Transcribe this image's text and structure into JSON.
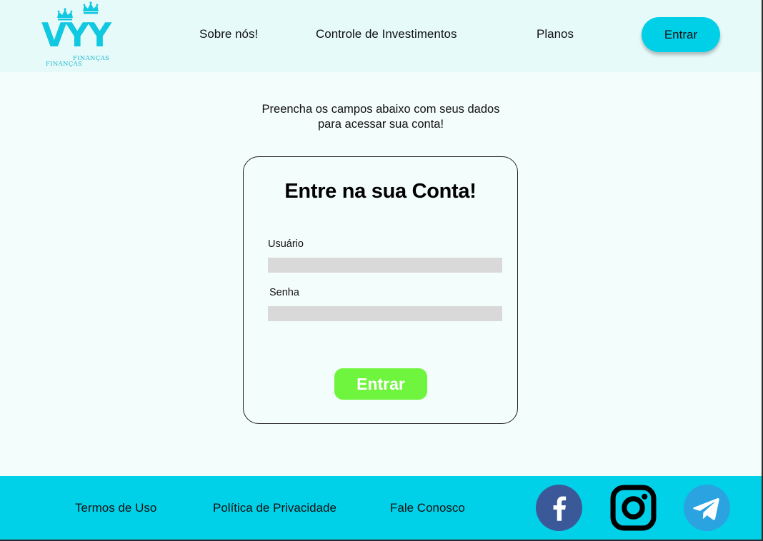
{
  "brand": {
    "logo_text": "VYY",
    "logo_subtitle_1": "FINANÇAS",
    "logo_subtitle_2": "FINANÇAS",
    "color": "#10c8e0"
  },
  "nav": {
    "items": [
      {
        "label": "Sobre nós!"
      },
      {
        "label": "Controle de Investimentos"
      },
      {
        "label": "Planos"
      }
    ],
    "login_button": "Entrar"
  },
  "intro": {
    "line1": "Preencha os campos abaixo com seus dados",
    "line2": "para acessar sua conta!"
  },
  "login_card": {
    "title": "Entre na sua Conta!",
    "user_label": "Usuário",
    "user_value": "",
    "password_label": "Senha",
    "password_value": "",
    "submit_label": "Entrar"
  },
  "footer": {
    "links": [
      {
        "label": "Termos de Uso"
      },
      {
        "label": "Política de Privacidade"
      },
      {
        "label": "Fale Conosco"
      }
    ],
    "social": [
      {
        "icon": "facebook-icon",
        "color": "#3b5998"
      },
      {
        "icon": "instagram-icon",
        "color": "#000000"
      },
      {
        "icon": "telegram-icon",
        "color": "#2aa3e0"
      }
    ]
  },
  "colors": {
    "header_bg": "#e6fafa",
    "page_bg": "#f3fdfb",
    "accent": "#00cfe8",
    "submit_button": "#6ff53d",
    "input_bg": "#d9d9d9"
  }
}
